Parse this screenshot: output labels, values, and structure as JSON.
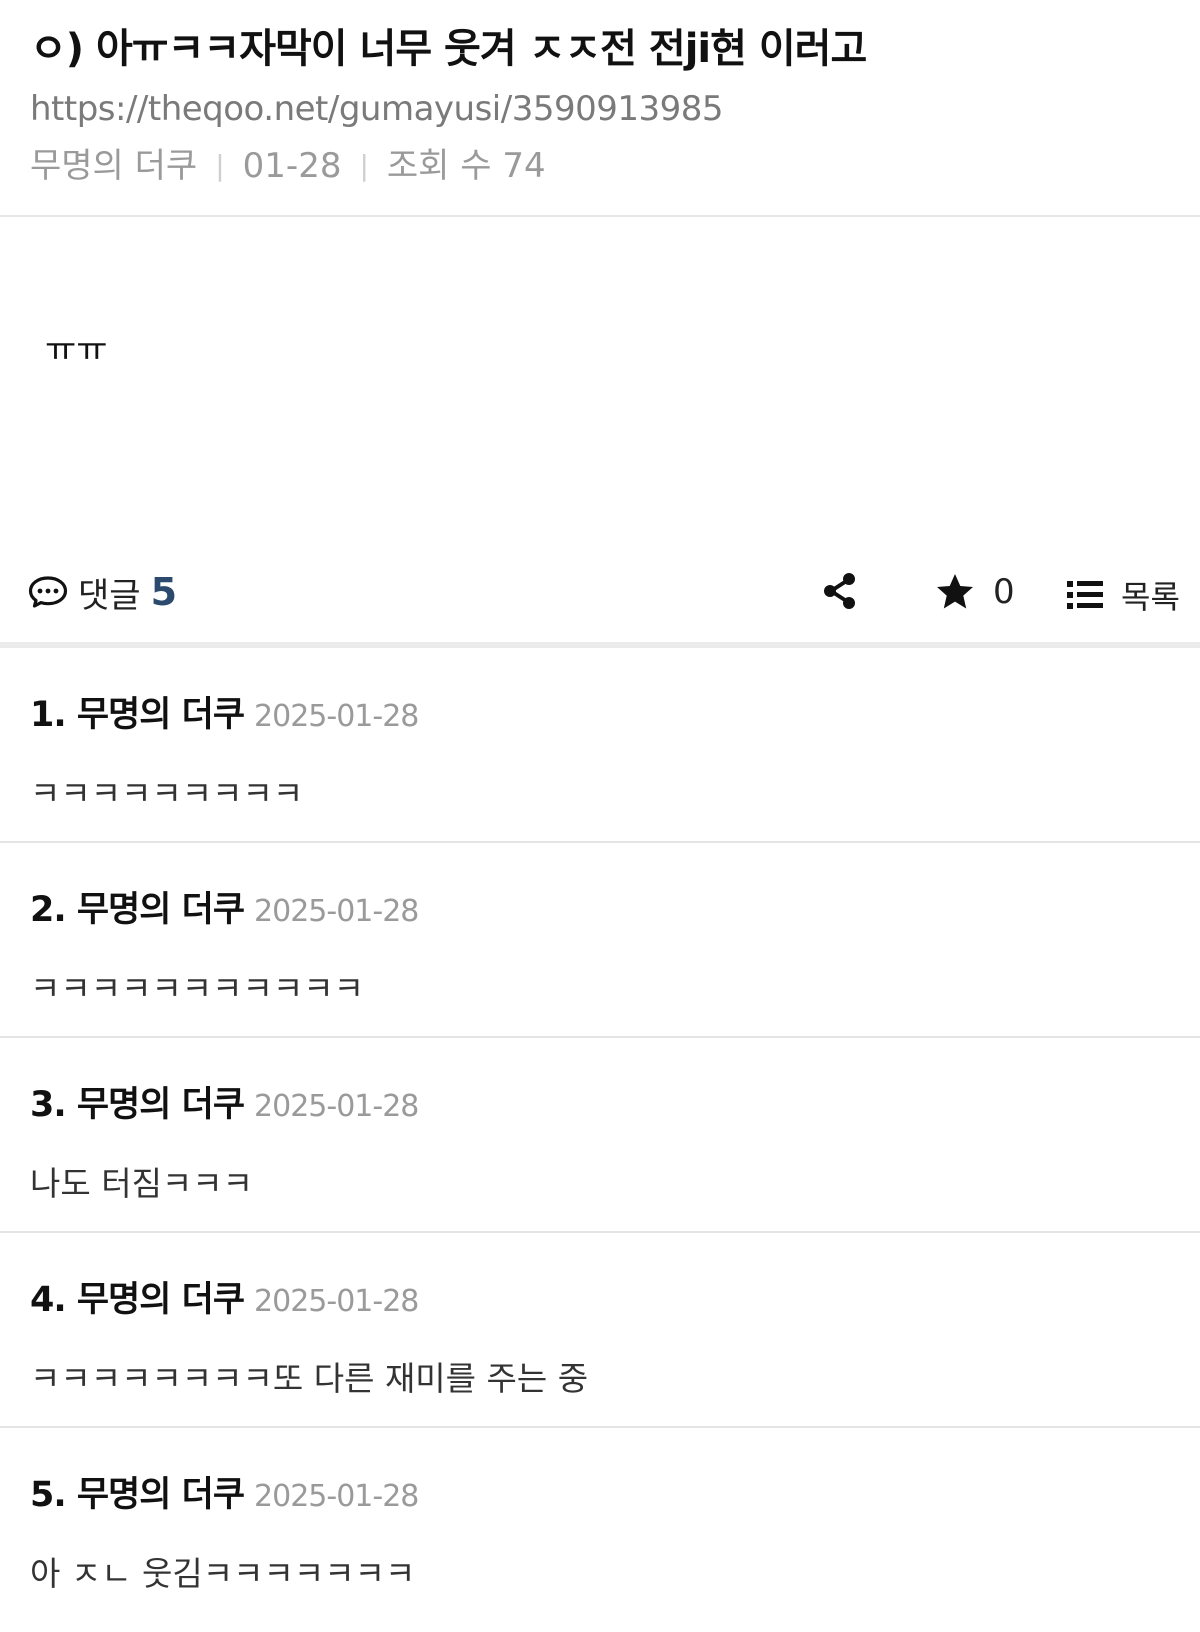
{
  "post": {
    "title": "ㅇ) 아ㅠㅋㅋ자막이 너무 웃겨 ㅈㅈ전 전ji현 이러고",
    "url": "https://theqoo.net/gumayusi/3590913985",
    "author": "무명의 더쿠",
    "date": "01-28",
    "views": "조회 수 74",
    "body": "ㅠㅠ"
  },
  "toolbar": {
    "comment_label": "댓글",
    "comment_count": "5",
    "star_count": "0",
    "list_label": "목록",
    "icons": [
      "comment-bubble-icon",
      "share-icon",
      "star-icon",
      "list-icon"
    ]
  },
  "comments": [
    {
      "author": "1. 무명의 더쿠",
      "date": "2025-01-28",
      "text": "ㅋㅋㅋㅋㅋㅋㅋㅋㅋ"
    },
    {
      "author": "2. 무명의 더쿠",
      "date": "2025-01-28",
      "text": "ㅋㅋㅋㅋㅋㅋㅋㅋㅋㅋㅋ"
    },
    {
      "author": "3. 무명의 더쿠",
      "date": "2025-01-28",
      "text": "나도 터짐ㅋㅋㅋ"
    },
    {
      "author": "4. 무명의 더쿠",
      "date": "2025-01-28",
      "text": "ㅋㅋㅋㅋㅋㅋㅋㅋ또 다른 재미를 주는 중"
    },
    {
      "author": "5. 무명의 더쿠",
      "date": "2025-01-28",
      "text": "아 ㅈㄴ 웃김ㅋㅋㅋㅋㅋㅋㅋ"
    }
  ],
  "colors": {
    "accent_count": "#2b4a6e",
    "muted_text": "#9a9a9a",
    "divider": "#e4e4e4"
  }
}
